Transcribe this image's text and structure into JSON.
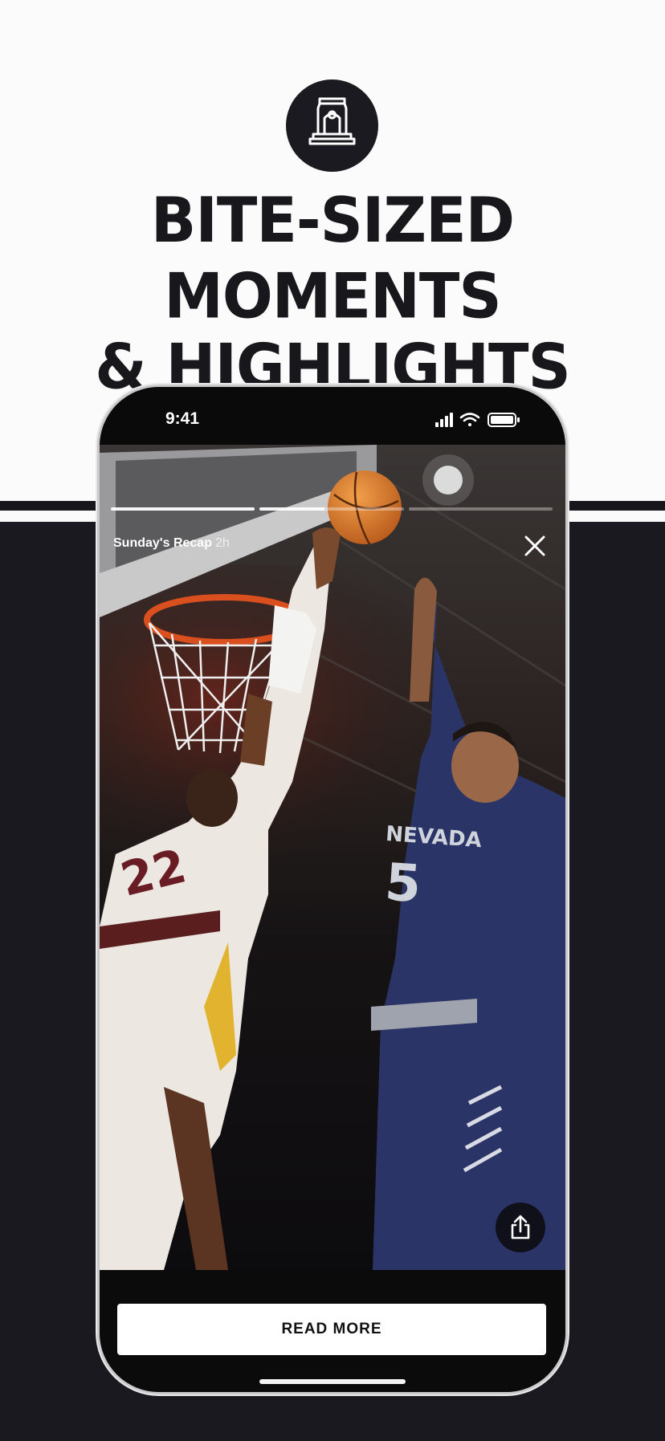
{
  "headline": {
    "line1": "BITE-SIZED MOMENTS",
    "line2": "& HIGHLIGHTS"
  },
  "logo": {
    "icon": "arena-building-icon"
  },
  "status_bar": {
    "time": "9:41",
    "icons": [
      "cellular-signal-icon",
      "wifi-icon",
      "battery-icon"
    ]
  },
  "story": {
    "title": "Sunday's Recap",
    "age": "2h",
    "progress_segments": 3,
    "active_segment": 2,
    "active_progress": 0.45,
    "close_icon": "close-icon",
    "share_icon": "share-icon",
    "player_left_number": "22",
    "player_right_jersey": "NEVADA",
    "player_right_number": "5"
  },
  "cta": {
    "read_more_label": "READ MORE"
  },
  "colors": {
    "dark": "#1a1920",
    "light": "#fbfbfb",
    "jersey_navy": "#2a3466",
    "ball_orange": "#d9772b"
  }
}
